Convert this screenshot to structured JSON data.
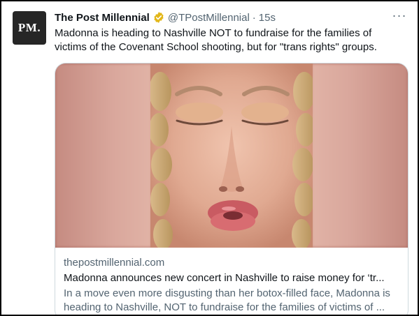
{
  "account": {
    "avatar_text": "PM.",
    "display_name": "The Post Millennial",
    "handle": "@TPostMillennial",
    "separator": "·",
    "timestamp": "15s",
    "verified_badge": "gold-verified-icon"
  },
  "menu_icon": "more-options-icon",
  "more_glyph": "···",
  "tweet": {
    "text": "Madonna is heading to Nashville NOT to fundraise for the families of victims of the Covenant School shooting, but for \"trans rights\" groups."
  },
  "card": {
    "domain": "thepostmillennial.com",
    "title": "Madonna announces new concert in Nashville to raise money for ‘tr...",
    "description_line1": "In a move even more disgusting than her botox-filled face, Madonna is",
    "description_line2": "heading to Nashville, NOT to fundraise for the families of victims of ..."
  },
  "colors": {
    "text_primary": "#0f1419",
    "text_secondary": "#536471",
    "card_border": "#cfd9de",
    "verified_gold": "#e2b719"
  }
}
